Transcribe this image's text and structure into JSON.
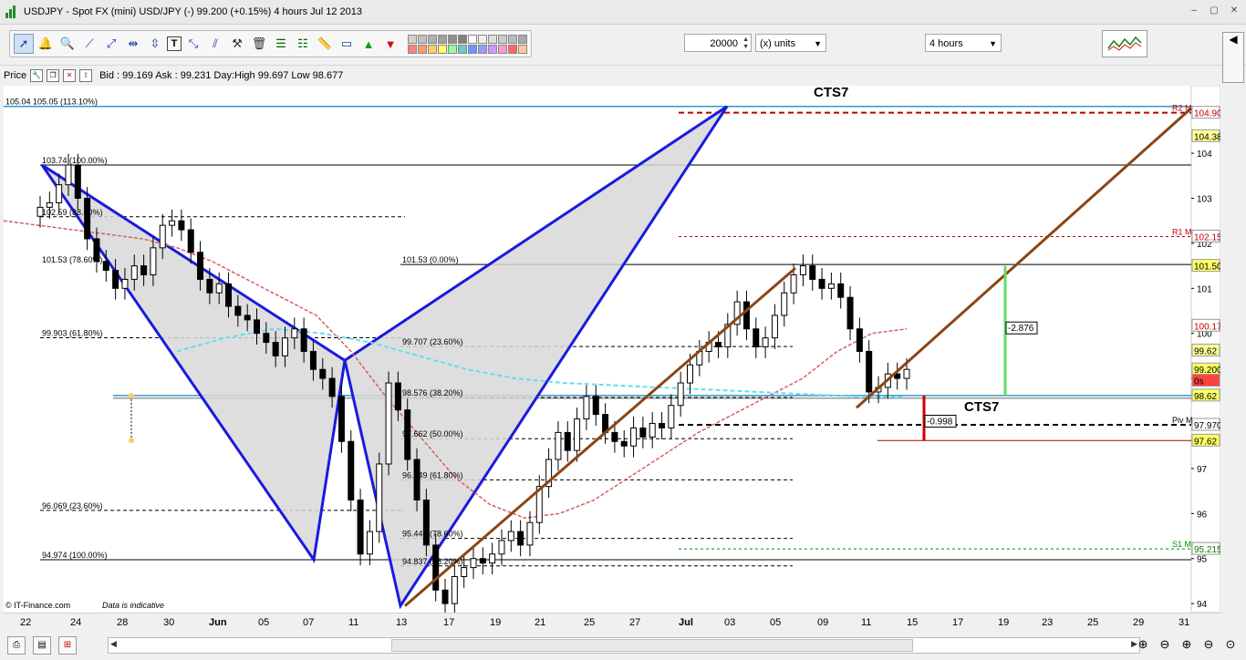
{
  "window": {
    "title": "USDJPY - Spot FX (mini) USD/JPY (-)    99.200 (+0.15%)    4 hours   Jul 12 2013",
    "controls": [
      "–",
      "▢",
      "✕"
    ]
  },
  "toolbar": {
    "quantity": "20000",
    "units": "(x) units",
    "timeframe": "4 hours",
    "tools": [
      "select-tool",
      "alert-bell-tool",
      "zoom-tool",
      "trendline-tool",
      "ray-tool",
      "horizontal-line-tool",
      "vertical-line-tool",
      "text-tool",
      "channel-tool",
      "parallel-tool",
      "gann-tool",
      "delete-tool",
      "fibonacci-tool",
      "fib-fan-tool",
      "ruler-tool",
      "rectangle-tool",
      "buy-arrow-tool",
      "sell-arrow-tool"
    ],
    "swatch_colors": [
      "#d0d0d0",
      "#c0c0c0",
      "#b0b0b0",
      "#a0a0a0",
      "#909090",
      "#808080",
      "#ffffff",
      "#eeeeee",
      "#dddddd",
      "#cccccc",
      "#bbbbbb",
      "#aaaaaa",
      "#ff8080",
      "#ff9966",
      "#ffcc66",
      "#ffff66",
      "#99ff99",
      "#66cccc",
      "#6699ff",
      "#9999ff",
      "#cc99ff",
      "#ff99cc",
      "#ff6666",
      "#ffcc99"
    ]
  },
  "info_bar": {
    "price_label": "Price",
    "quote": "Bid : 99.169 Ask : 99.231 Day:High 99.697 Low 98.677"
  },
  "chart_data": {
    "type": "candlestick",
    "title": "",
    "annotations": {
      "cts_top": "CTS7",
      "cts_mid": "CTS7",
      "box_up": "-2.876",
      "box_down": "-0.998",
      "copyright": "© IT-Finance.com",
      "indicative": "Data is indicative",
      "fib_left": [
        {
          "label": "105.04  105.05 (113.10%)",
          "y": 105.04
        },
        {
          "label": "103.74 (100.00%)",
          "y": 103.74
        },
        {
          "label": "102.59 (88.60%)",
          "y": 102.59
        },
        {
          "label": "101.53 (78.60%)",
          "y": 101.53
        },
        {
          "label": "99.903 (61.80%)",
          "y": 99.903
        },
        {
          "label": "96.069 (23.60%)",
          "y": 96.069
        },
        {
          "label": "94.974 (100.00%)",
          "y": 94.974
        }
      ],
      "fib_mid": [
        {
          "label": "101.53 (0.00%)",
          "y": 101.53
        },
        {
          "label": "99.707 (23.60%)",
          "y": 99.707
        },
        {
          "label": "98.576 (38.20%)",
          "y": 98.576
        },
        {
          "label": "97.662 (50.00%)",
          "y": 97.662
        },
        {
          "label": "96.749 (61.80%)",
          "y": 96.749
        },
        {
          "label": "95.448 (78.60%)",
          "y": 95.448
        },
        {
          "label": "94.837 (88.20%)",
          "y": 94.837
        }
      ],
      "pivots": [
        {
          "label": "R2 M",
          "y": 104.9
        },
        {
          "label": "R1 M",
          "y": 102.15
        },
        {
          "label": "Piv M",
          "y": 97.97
        },
        {
          "label": "S1 M",
          "y": 95.215
        }
      ]
    },
    "price_tags": [
      {
        "text": "104.90",
        "y": 104.9,
        "bg": "#ffffff",
        "fg": "#c00000"
      },
      {
        "text": "104.38",
        "y": 104.38,
        "bg": "#ffff99",
        "fg": "#000000"
      },
      {
        "text": "102.15",
        "y": 102.15,
        "bg": "#ffffff",
        "fg": "#c00000"
      },
      {
        "text": "101.50",
        "y": 101.5,
        "bg": "#ffff66",
        "fg": "#000000"
      },
      {
        "text": "100.17",
        "y": 100.17,
        "bg": "#ffffff",
        "fg": "#c00000"
      },
      {
        "text": "99.62",
        "y": 99.62,
        "bg": "#ffff99",
        "fg": "#000000"
      },
      {
        "text": "99.200",
        "y": 99.2,
        "bg": "#ffff66",
        "fg": "#000000"
      },
      {
        "text": "0s",
        "y": 98.95,
        "bg": "#ff4040",
        "fg": "#000000"
      },
      {
        "text": "98.62",
        "y": 98.62,
        "bg": "#ffff66",
        "fg": "#000000"
      },
      {
        "text": "97.970",
        "y": 97.97,
        "bg": "#ffffff",
        "fg": "#000000"
      },
      {
        "text": "97.62",
        "y": 97.62,
        "bg": "#ffff66",
        "fg": "#000000"
      },
      {
        "text": "95.215",
        "y": 95.215,
        "bg": "#ffffff",
        "fg": "#008000"
      }
    ],
    "y_ticks": [
      "104",
      "103",
      "102",
      "101",
      "100",
      "99",
      "98",
      "97",
      "96",
      "95",
      "94"
    ],
    "y_range": [
      93.8,
      105.5
    ],
    "x_ticks": [
      "22",
      "24",
      "28",
      "30",
      "Jun",
      "05",
      "07",
      "11",
      "13",
      "17",
      "19",
      "21",
      "25",
      "27",
      "Jul",
      "03",
      "05",
      "09",
      "11",
      "15",
      "17",
      "19",
      "23",
      "25",
      "29",
      "31"
    ],
    "close_series": [
      102.8,
      102.9,
      103.3,
      103.74,
      103.0,
      102.1,
      101.6,
      101.4,
      101.0,
      101.2,
      101.5,
      101.3,
      101.9,
      102.4,
      102.5,
      102.3,
      101.8,
      101.2,
      100.9,
      101.1,
      100.6,
      100.4,
      100.3,
      100.0,
      99.8,
      99.5,
      99.9,
      100.1,
      99.6,
      99.2,
      99.0,
      98.6,
      97.6,
      96.3,
      95.1,
      95.6,
      97.1,
      98.9,
      98.3,
      97.2,
      96.3,
      95.3,
      94.3,
      94.0,
      94.6,
      94.8,
      95.0,
      94.9,
      95.1,
      95.4,
      95.6,
      95.3,
      95.8,
      96.6,
      97.2,
      97.8,
      97.4,
      98.1,
      98.6,
      98.2,
      97.8,
      97.6,
      97.5,
      97.9,
      97.7,
      98.0,
      97.9,
      98.4,
      98.9,
      99.3,
      99.6,
      99.8,
      99.7,
      100.2,
      100.7,
      100.1,
      99.7,
      99.9,
      100.4,
      100.9,
      101.3,
      101.5,
      101.2,
      101.0,
      101.1,
      100.8,
      100.1,
      99.6,
      98.7,
      98.8,
      99.1,
      99.0,
      99.2
    ],
    "ma_red": [
      102.5,
      102.4,
      102.3,
      102.2,
      102.1,
      101.9,
      101.6,
      101.2,
      100.8,
      100.4,
      99.6,
      98.6,
      97.7,
      96.8,
      96.2,
      95.9,
      96.0,
      96.3,
      96.8,
      97.3,
      97.8,
      98.2,
      98.6,
      99.0,
      99.6,
      100.0,
      100.1
    ],
    "ma_cyan": [
      99.6,
      99.9,
      100.1,
      100.0,
      99.8,
      99.5,
      99.2,
      99.0,
      98.9,
      98.85,
      98.8,
      98.75,
      98.7,
      98.65,
      98.6,
      98.58
    ],
    "colors": {
      "bull": "#ffffff",
      "bear": "#000000",
      "pattern_line": "#1a1adf",
      "pattern_fill": "#d8d8d8",
      "trend": "#8b4513",
      "ma_red": "#d46060",
      "ma_cyan": "#66ddee",
      "pivot": "#c00000",
      "support": "#009000",
      "hline": "#3399cc"
    }
  },
  "bottom": {
    "buttons": [
      "print-icon",
      "properties-icon",
      "indicator-icon"
    ],
    "zoom": [
      "⊕",
      "⊖",
      "⊕",
      "⊖",
      "⊙"
    ]
  }
}
